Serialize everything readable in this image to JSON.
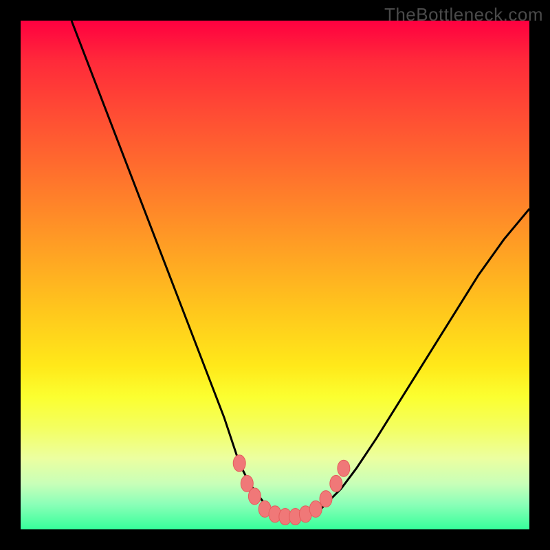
{
  "watermark": "TheBottleneck.com",
  "colors": {
    "frame": "#000000",
    "curve": "#000000",
    "marker_fill": "#f07878",
    "marker_stroke": "#e55c5c"
  },
  "chart_data": {
    "type": "line",
    "title": "",
    "xlabel": "",
    "ylabel": "",
    "xlim": [
      0,
      100
    ],
    "ylim": [
      0,
      100
    ],
    "grid": false,
    "legend": false,
    "notes": "Bottleneck-curve style plot on a red-to-green vertical gradient. No visible tick labels or axis text; values are estimated from pixel positions in a 100x100 coordinate space (0,0 bottom-left).",
    "series": [
      {
        "name": "curve",
        "x": [
          10,
          15,
          20,
          25,
          30,
          35,
          40,
          43,
          45,
          48,
          50,
          52,
          55,
          58,
          60,
          63,
          66,
          70,
          75,
          80,
          85,
          90,
          95,
          100
        ],
        "y": [
          100,
          87,
          74,
          61,
          48,
          35,
          22,
          13,
          9,
          5,
          3,
          2.5,
          2.5,
          3,
          5,
          8,
          12,
          18,
          26,
          34,
          42,
          50,
          57,
          63
        ]
      }
    ],
    "markers": [
      {
        "x": 43,
        "y": 13
      },
      {
        "x": 44.5,
        "y": 9
      },
      {
        "x": 46,
        "y": 6.5
      },
      {
        "x": 48,
        "y": 4
      },
      {
        "x": 50,
        "y": 3
      },
      {
        "x": 52,
        "y": 2.5
      },
      {
        "x": 54,
        "y": 2.5
      },
      {
        "x": 56,
        "y": 3
      },
      {
        "x": 58,
        "y": 4
      },
      {
        "x": 60,
        "y": 6
      },
      {
        "x": 62,
        "y": 9
      },
      {
        "x": 63.5,
        "y": 12
      }
    ]
  }
}
